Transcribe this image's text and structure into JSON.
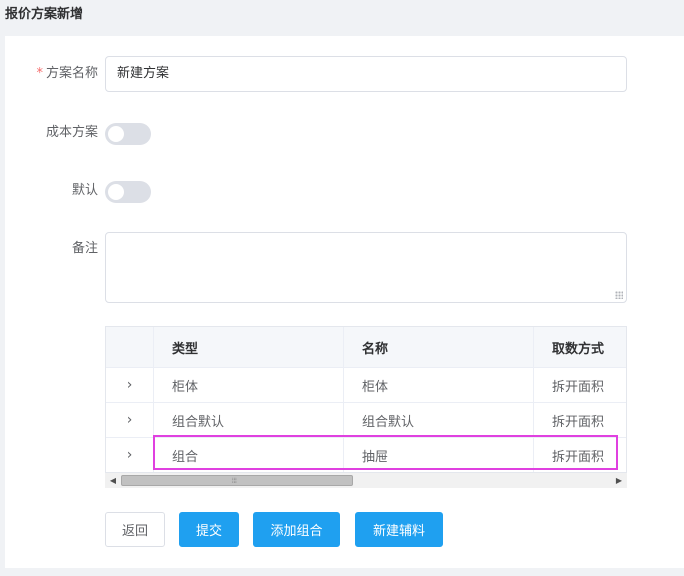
{
  "page": {
    "title": "报价方案新增"
  },
  "form": {
    "name_label": "方案名称",
    "required_mark": "*",
    "name_value": "新建方案",
    "cost_label": "成本方案",
    "cost_on": false,
    "default_label": "默认",
    "default_on": false,
    "remark_label": "备注",
    "remark_value": ""
  },
  "table": {
    "columns": [
      "",
      "类型",
      "名称",
      "取数方式"
    ],
    "rows": [
      {
        "type": "柜体",
        "name": "柜体",
        "method": "拆开面积"
      },
      {
        "type": "组合默认",
        "name": "组合默认",
        "method": "拆开面积"
      },
      {
        "type": "组合",
        "name": "抽屉",
        "method": "拆开面积"
      }
    ],
    "scroll_left_arrow": "◀",
    "scroll_right_arrow": "▶",
    "scroll_grip": "⦙⦙⦙",
    "highlight_color": "#e040e0"
  },
  "buttons": {
    "back": "返回",
    "submit": "提交",
    "add_group": "添加组合",
    "new_material": "新建辅料"
  },
  "colors": {
    "primary": "#1fa0f0",
    "required": "#f56c6c"
  }
}
